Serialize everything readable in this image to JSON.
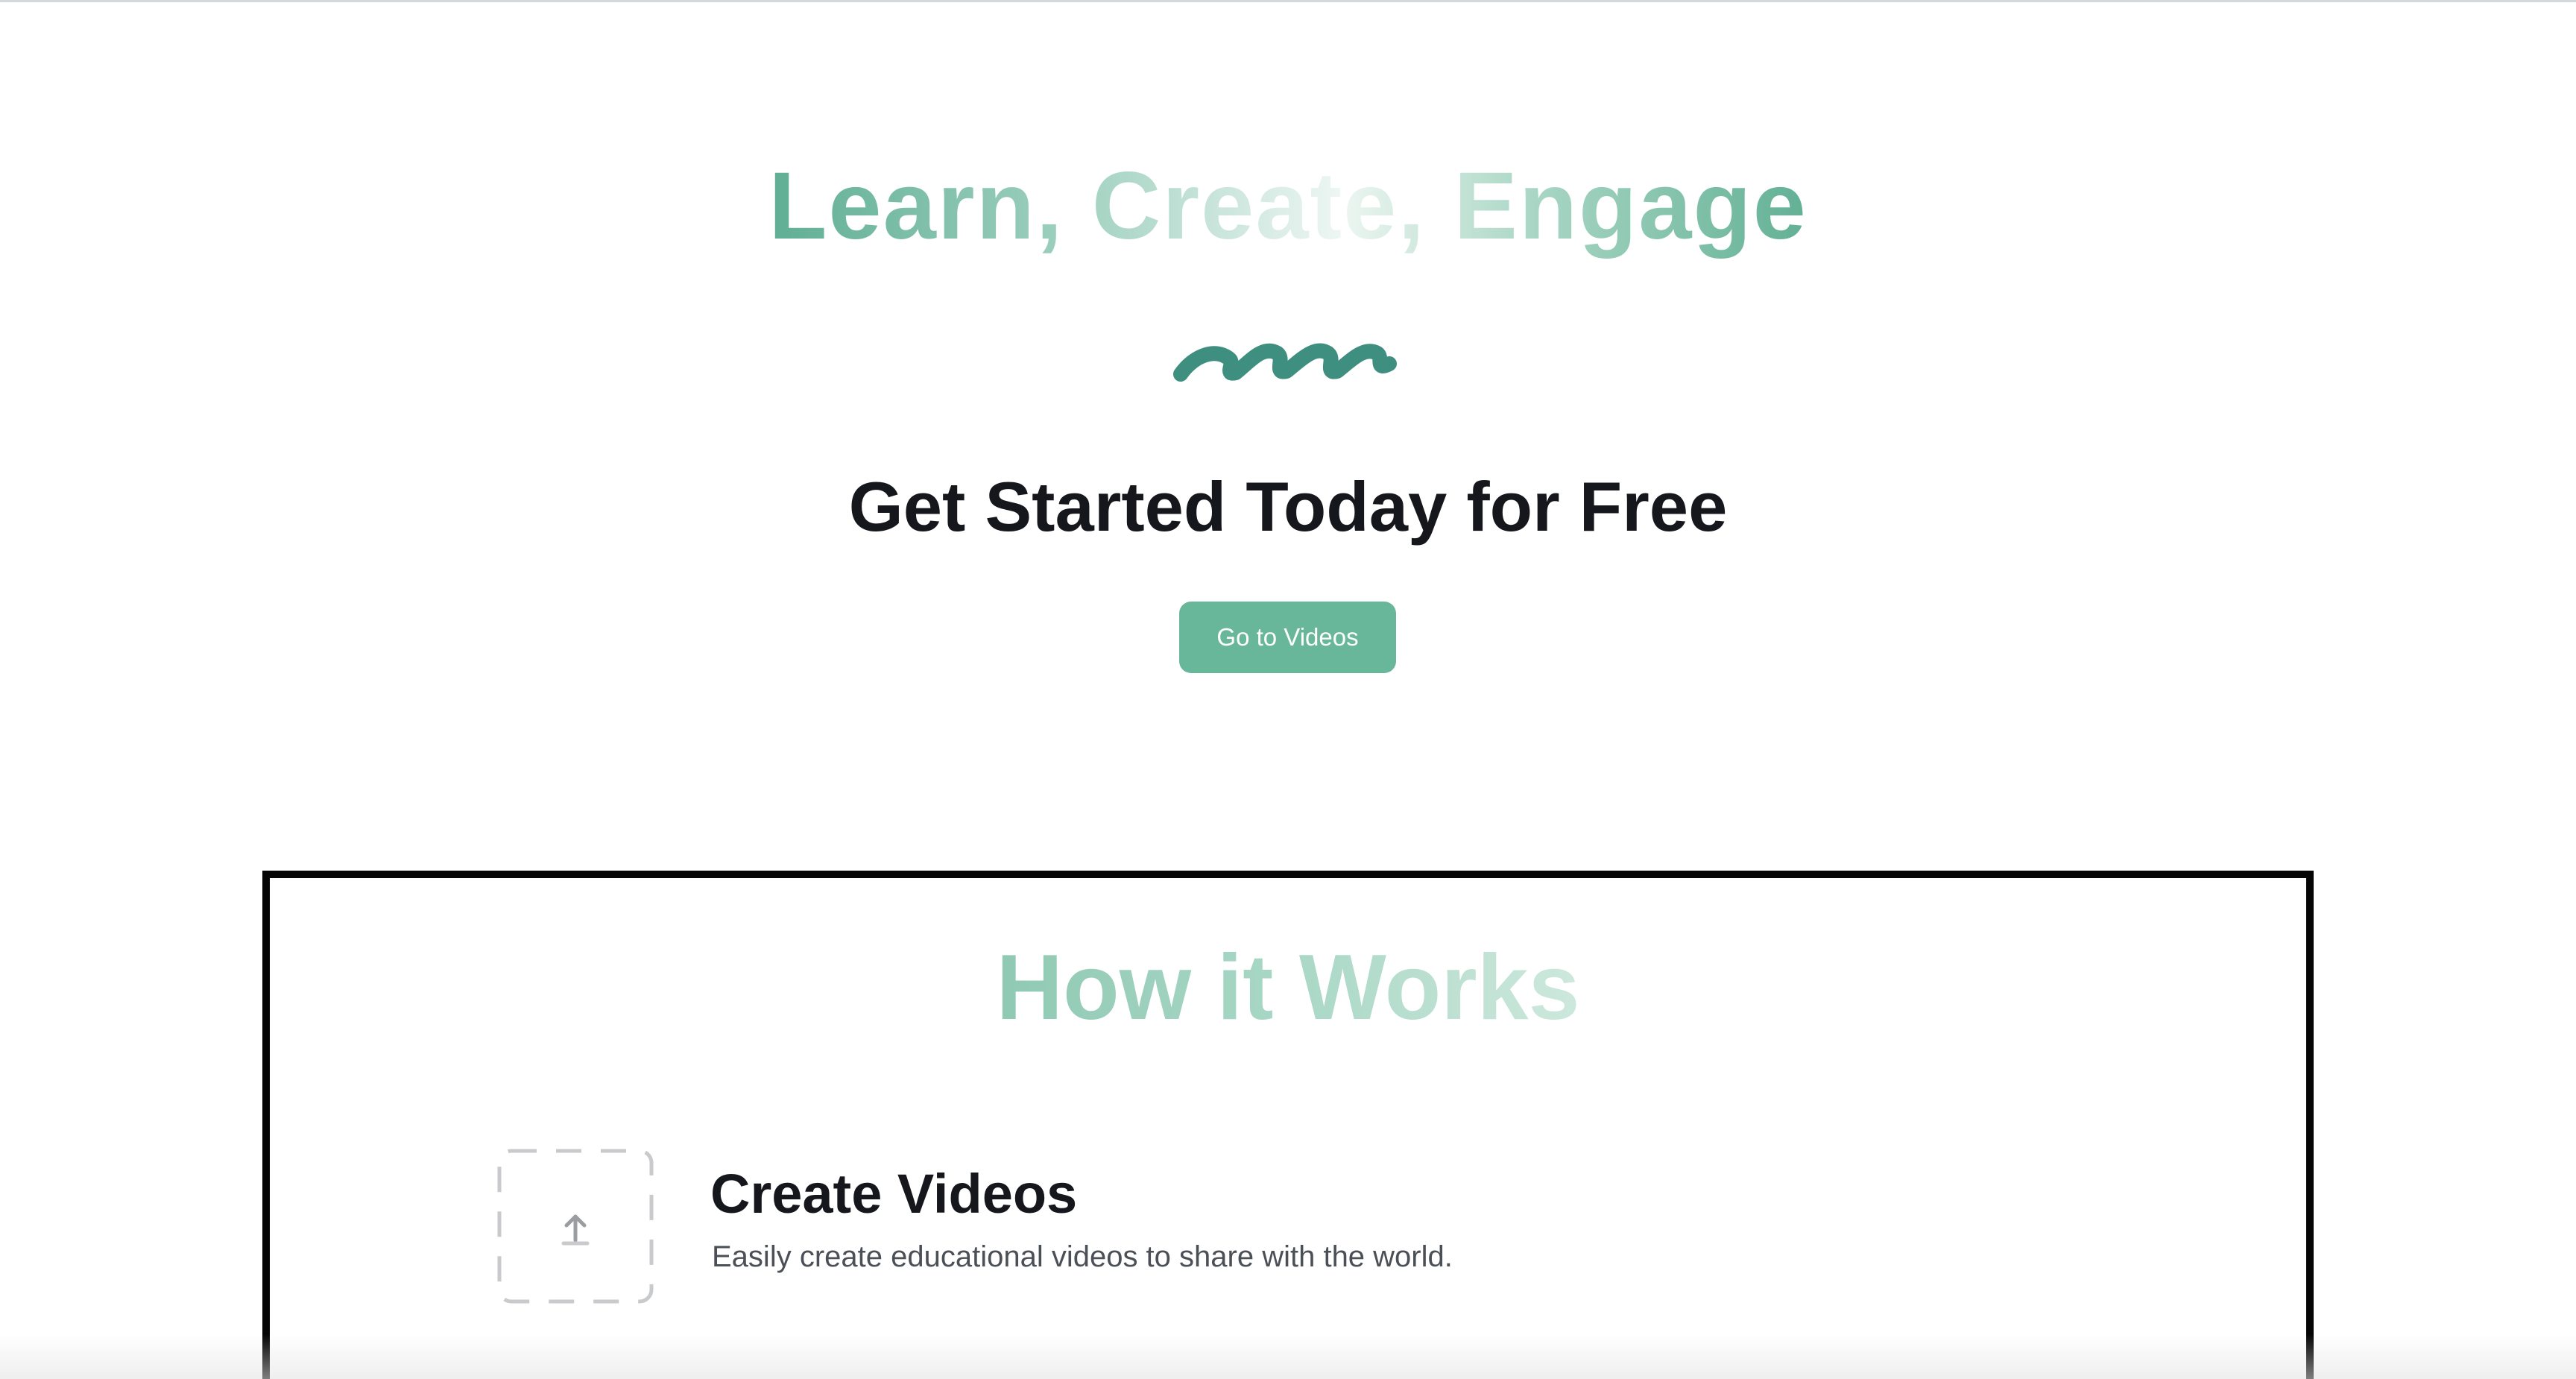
{
  "hero": {
    "title": "Learn, Create, Engage",
    "subtitle": "Get Started Today for Free",
    "cta_label": "Go to Videos"
  },
  "how_it_works": {
    "title": "How it Works",
    "steps": [
      {
        "icon": "upload-icon",
        "title": "Create Videos",
        "description": "Easily create educational videos to share with the world."
      }
    ]
  },
  "colors": {
    "accent": "#69b79b",
    "squiggle": "#3f8f80",
    "heading_text": "#15171c",
    "body_text": "#4b4f56",
    "panel_border": "#050505"
  }
}
